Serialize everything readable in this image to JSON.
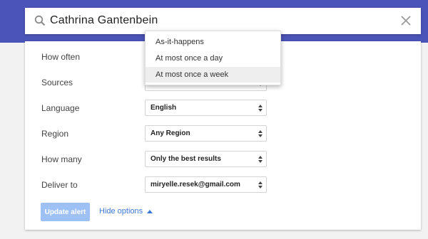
{
  "search": {
    "query": "Cathrina Gantenbein"
  },
  "options": {
    "how_often_label": "How often",
    "sources_label": "Sources",
    "language_label": "Language",
    "language_value": "English",
    "region_label": "Region",
    "region_value": "Any Region",
    "how_many_label": "How many",
    "how_many_value": "Only the best results",
    "deliver_to_label": "Deliver to",
    "deliver_to_value": "miryelle.resek@gmail.com"
  },
  "how_often_dropdown": {
    "items": [
      "As-it-happens",
      "At most once a day",
      "At most once a week"
    ],
    "highlighted": "At most once a week"
  },
  "actions": {
    "update_label": "Update alert",
    "hide_options_label": "Hide options"
  },
  "colors": {
    "header_band": "#4b54b8",
    "accent_link": "#3c78d8",
    "button_disabled": "#9dc1f4"
  },
  "icons": [
    "search-icon",
    "close-icon",
    "updown-arrows-icon",
    "caret-up-icon"
  ]
}
